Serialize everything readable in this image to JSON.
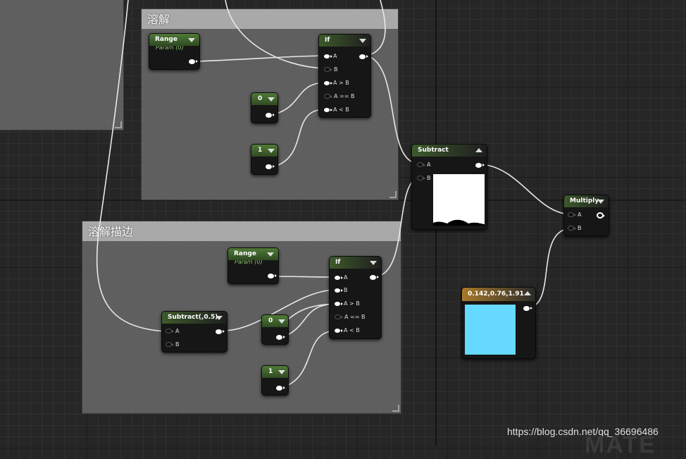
{
  "comments": {
    "dissolve": "溶解",
    "dissolve_edge": "溶解描边"
  },
  "nodes": {
    "range_top": {
      "title": "Range",
      "subtitle": "Param (0)"
    },
    "if_top": {
      "title": "If",
      "pins": [
        "A",
        "B",
        "A > B",
        "A == B",
        "A < B"
      ]
    },
    "const_top_0": {
      "value": "0"
    },
    "const_top_1": {
      "value": "1"
    },
    "subtract_main": {
      "title": "Subtract",
      "pins": [
        "A",
        "B"
      ]
    },
    "multiply": {
      "title": "Multiply",
      "pins": [
        "A",
        "B"
      ]
    },
    "range_bottom": {
      "title": "Range",
      "subtitle": "Param (0)"
    },
    "if_bottom": {
      "title": "If",
      "pins": [
        "A",
        "B",
        "A > B",
        "A == B",
        "A < B"
      ]
    },
    "subtract_edge": {
      "title": "Subtract(,0.5)",
      "pins": [
        "A",
        "B"
      ]
    },
    "const_bottom_0": {
      "value": "0"
    },
    "const_bottom_1": {
      "value": "1"
    },
    "color_constant": {
      "title": "0.142,0.76,1.91",
      "swatch_color": "#66d9ff"
    }
  },
  "watermark": "https://blog.csdn.net/qq_36696486",
  "bottom_mark": "MATE",
  "colors": {
    "node_header_green": "#507a38",
    "color_node_header": "#a87a2a",
    "wire": "#ffffff"
  }
}
